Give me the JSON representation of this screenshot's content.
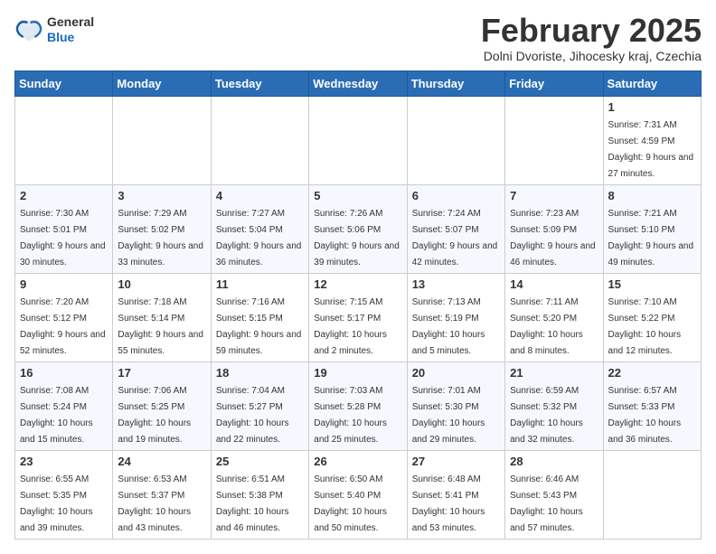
{
  "logo": {
    "general": "General",
    "blue": "Blue"
  },
  "header": {
    "title": "February 2025",
    "subtitle": "Dolni Dvoriste, Jihocesky kraj, Czechia"
  },
  "days_of_week": [
    "Sunday",
    "Monday",
    "Tuesday",
    "Wednesday",
    "Thursday",
    "Friday",
    "Saturday"
  ],
  "weeks": [
    [
      {
        "day": "",
        "info": ""
      },
      {
        "day": "",
        "info": ""
      },
      {
        "day": "",
        "info": ""
      },
      {
        "day": "",
        "info": ""
      },
      {
        "day": "",
        "info": ""
      },
      {
        "day": "",
        "info": ""
      },
      {
        "day": "1",
        "info": "Sunrise: 7:31 AM\nSunset: 4:59 PM\nDaylight: 9 hours and 27 minutes."
      }
    ],
    [
      {
        "day": "2",
        "info": "Sunrise: 7:30 AM\nSunset: 5:01 PM\nDaylight: 9 hours and 30 minutes."
      },
      {
        "day": "3",
        "info": "Sunrise: 7:29 AM\nSunset: 5:02 PM\nDaylight: 9 hours and 33 minutes."
      },
      {
        "day": "4",
        "info": "Sunrise: 7:27 AM\nSunset: 5:04 PM\nDaylight: 9 hours and 36 minutes."
      },
      {
        "day": "5",
        "info": "Sunrise: 7:26 AM\nSunset: 5:06 PM\nDaylight: 9 hours and 39 minutes."
      },
      {
        "day": "6",
        "info": "Sunrise: 7:24 AM\nSunset: 5:07 PM\nDaylight: 9 hours and 42 minutes."
      },
      {
        "day": "7",
        "info": "Sunrise: 7:23 AM\nSunset: 5:09 PM\nDaylight: 9 hours and 46 minutes."
      },
      {
        "day": "8",
        "info": "Sunrise: 7:21 AM\nSunset: 5:10 PM\nDaylight: 9 hours and 49 minutes."
      }
    ],
    [
      {
        "day": "9",
        "info": "Sunrise: 7:20 AM\nSunset: 5:12 PM\nDaylight: 9 hours and 52 minutes."
      },
      {
        "day": "10",
        "info": "Sunrise: 7:18 AM\nSunset: 5:14 PM\nDaylight: 9 hours and 55 minutes."
      },
      {
        "day": "11",
        "info": "Sunrise: 7:16 AM\nSunset: 5:15 PM\nDaylight: 9 hours and 59 minutes."
      },
      {
        "day": "12",
        "info": "Sunrise: 7:15 AM\nSunset: 5:17 PM\nDaylight: 10 hours and 2 minutes."
      },
      {
        "day": "13",
        "info": "Sunrise: 7:13 AM\nSunset: 5:19 PM\nDaylight: 10 hours and 5 minutes."
      },
      {
        "day": "14",
        "info": "Sunrise: 7:11 AM\nSunset: 5:20 PM\nDaylight: 10 hours and 8 minutes."
      },
      {
        "day": "15",
        "info": "Sunrise: 7:10 AM\nSunset: 5:22 PM\nDaylight: 10 hours and 12 minutes."
      }
    ],
    [
      {
        "day": "16",
        "info": "Sunrise: 7:08 AM\nSunset: 5:24 PM\nDaylight: 10 hours and 15 minutes."
      },
      {
        "day": "17",
        "info": "Sunrise: 7:06 AM\nSunset: 5:25 PM\nDaylight: 10 hours and 19 minutes."
      },
      {
        "day": "18",
        "info": "Sunrise: 7:04 AM\nSunset: 5:27 PM\nDaylight: 10 hours and 22 minutes."
      },
      {
        "day": "19",
        "info": "Sunrise: 7:03 AM\nSunset: 5:28 PM\nDaylight: 10 hours and 25 minutes."
      },
      {
        "day": "20",
        "info": "Sunrise: 7:01 AM\nSunset: 5:30 PM\nDaylight: 10 hours and 29 minutes."
      },
      {
        "day": "21",
        "info": "Sunrise: 6:59 AM\nSunset: 5:32 PM\nDaylight: 10 hours and 32 minutes."
      },
      {
        "day": "22",
        "info": "Sunrise: 6:57 AM\nSunset: 5:33 PM\nDaylight: 10 hours and 36 minutes."
      }
    ],
    [
      {
        "day": "23",
        "info": "Sunrise: 6:55 AM\nSunset: 5:35 PM\nDaylight: 10 hours and 39 minutes."
      },
      {
        "day": "24",
        "info": "Sunrise: 6:53 AM\nSunset: 5:37 PM\nDaylight: 10 hours and 43 minutes."
      },
      {
        "day": "25",
        "info": "Sunrise: 6:51 AM\nSunset: 5:38 PM\nDaylight: 10 hours and 46 minutes."
      },
      {
        "day": "26",
        "info": "Sunrise: 6:50 AM\nSunset: 5:40 PM\nDaylight: 10 hours and 50 minutes."
      },
      {
        "day": "27",
        "info": "Sunrise: 6:48 AM\nSunset: 5:41 PM\nDaylight: 10 hours and 53 minutes."
      },
      {
        "day": "28",
        "info": "Sunrise: 6:46 AM\nSunset: 5:43 PM\nDaylight: 10 hours and 57 minutes."
      },
      {
        "day": "",
        "info": ""
      }
    ]
  ]
}
